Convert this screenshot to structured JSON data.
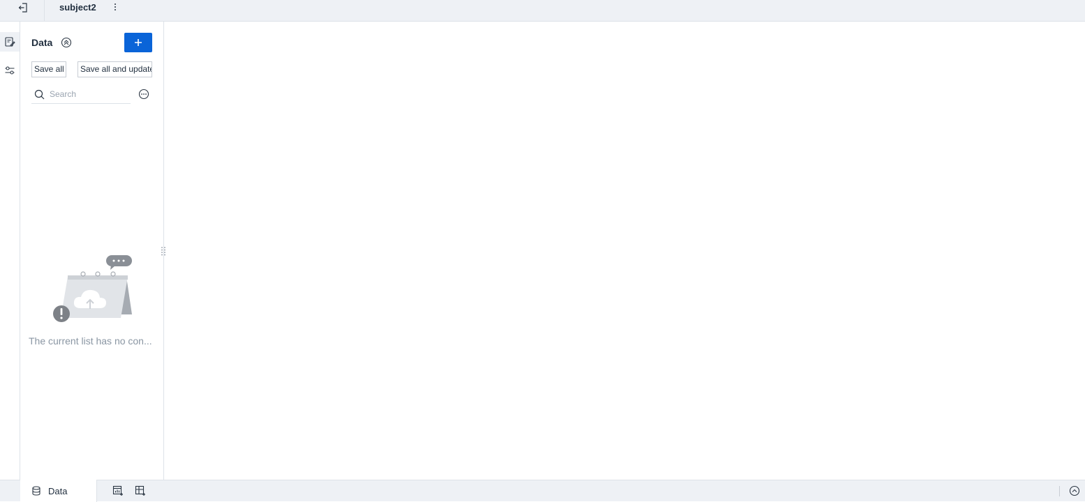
{
  "header": {
    "subject_title": "subject2",
    "back_icon": "exit-icon",
    "more_icon": "vertical-dots-icon"
  },
  "rail": {
    "items": [
      {
        "icon": "data-edit-icon",
        "active": true
      },
      {
        "icon": "filter-settings-icon",
        "active": false
      }
    ]
  },
  "panel": {
    "title": "Data",
    "add_button_label": "+",
    "save_all_label": "Save all",
    "save_all_update_label": "Save all and update",
    "search_placeholder": "Search",
    "search_value": "",
    "empty_text": "The current list has no con..."
  },
  "bottom": {
    "tab_label": "Data",
    "tab_icon": "database-icon"
  },
  "colors": {
    "accent": "#0a64d8",
    "bar_background": "#eef1f5",
    "border": "#dde2e8",
    "muted_text": "#8a96a3"
  }
}
